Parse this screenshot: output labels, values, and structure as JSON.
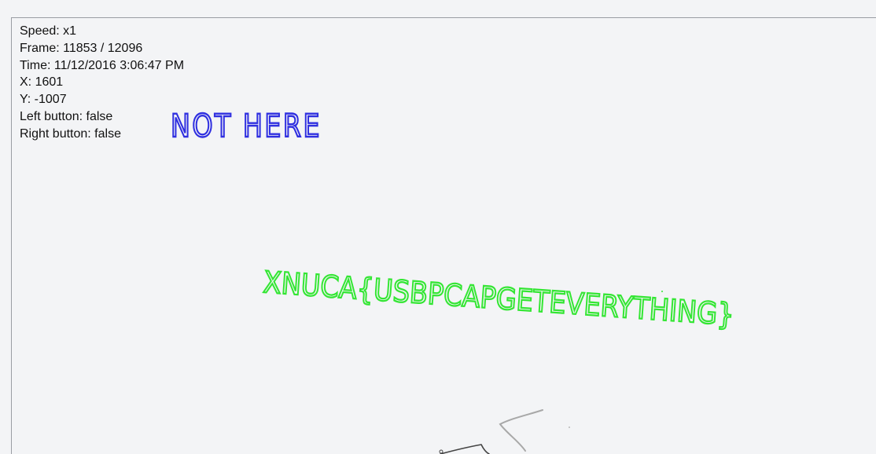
{
  "info": {
    "speed": "Speed: x1",
    "frame": "Frame: 11853 / 12096",
    "time": "Time: 11/12/2016 3:06:47 PM",
    "x": "X: 1601",
    "y": "Y: -1007",
    "left_button": "Left button: false",
    "right_button": "Right button: false"
  },
  "handwriting": {
    "note": "NOT HERE",
    "flag": "XNUCA{USBPCAPGETEVERYTHING}"
  },
  "colors": {
    "note": "#2f2fe0",
    "flag": "#33e633",
    "sketch_dark": "#444444",
    "sketch_light": "#a8a8a8",
    "border": "#9a9da3",
    "background": "#f3f4f6"
  }
}
